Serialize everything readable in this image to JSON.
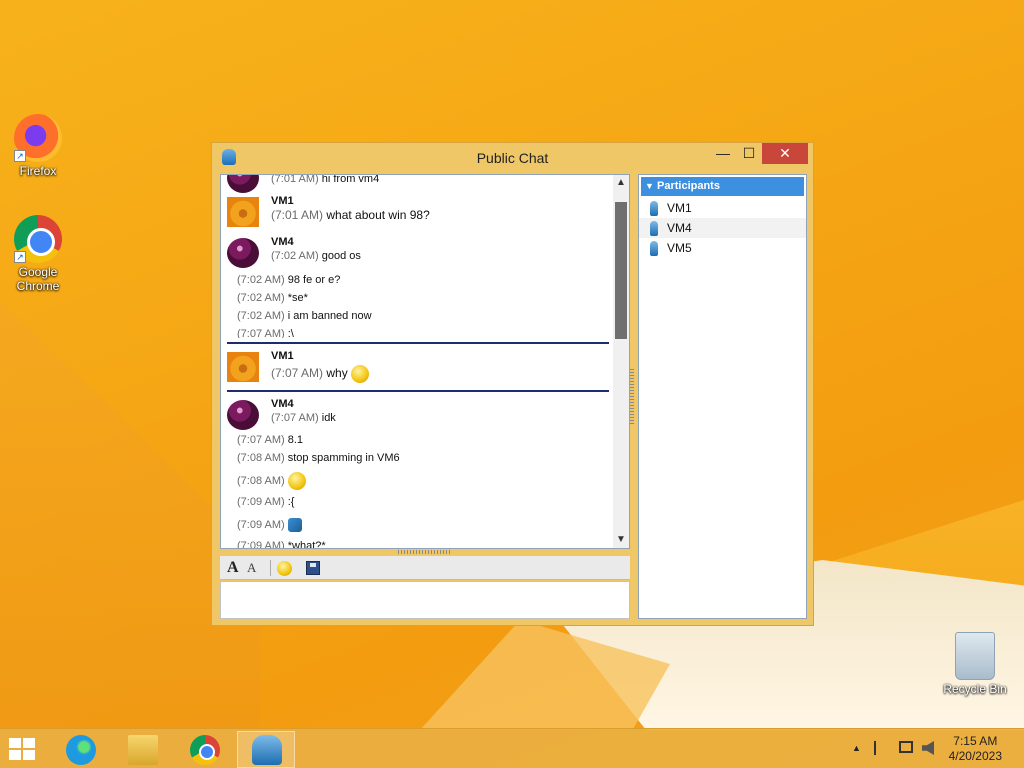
{
  "desktop": {
    "icons": [
      {
        "label": "Firefox"
      },
      {
        "label": "Google Chrome"
      },
      {
        "label": "Recycle Bin"
      }
    ]
  },
  "window": {
    "title": "Public Chat",
    "controls": {
      "minimize": "—",
      "maximize": "☐",
      "close": "✕"
    }
  },
  "chat": {
    "top_line": {
      "time": "(7:01 AM)",
      "text": "hi from vm4"
    },
    "block1": {
      "sender": "VM1",
      "time": "(7:01 AM)",
      "text": "what about win 98?"
    },
    "block2": {
      "sender": "VM4",
      "first": {
        "time": "(7:02 AM)",
        "text": "good os"
      },
      "lines": [
        {
          "time": "(7:02 AM)",
          "text": "98 fe or e?"
        },
        {
          "time": "(7:02 AM)",
          "text": "*se*"
        },
        {
          "time": "(7:02 AM)",
          "text": "i am banned now"
        },
        {
          "time": "(7:07 AM)",
          "text": ":\\"
        }
      ]
    },
    "block3": {
      "sender": "VM1",
      "time": "(7:07 AM)",
      "text": "why"
    },
    "block4": {
      "sender": "VM4",
      "first": {
        "time": "(7:07 AM)",
        "text": "idk"
      },
      "lines": [
        {
          "time": "(7:07 AM)",
          "text": "8.1"
        },
        {
          "time": "(7:08 AM)",
          "text": "stop spamming in VM6"
        },
        {
          "time": "(7:08 AM)",
          "text": ""
        },
        {
          "time": "(7:09 AM)",
          "text": ":{"
        },
        {
          "time": "(7:09 AM)",
          "text": ""
        },
        {
          "time": "(7:09 AM)",
          "text": "*what?*"
        }
      ]
    }
  },
  "toolbar": {
    "font": "A",
    "color": "A"
  },
  "participants": {
    "header": "Participants",
    "items": [
      "VM1",
      "VM4",
      "VM5"
    ]
  },
  "taskbar": {
    "clock_time": "7:15 AM",
    "clock_date": "4/20/2023",
    "tray_arrow": "▲"
  },
  "colors": {
    "accent": "#3d8fe0",
    "close": "#c9463a",
    "window_frame": "#f0c766",
    "divider": "#1d2b73"
  }
}
